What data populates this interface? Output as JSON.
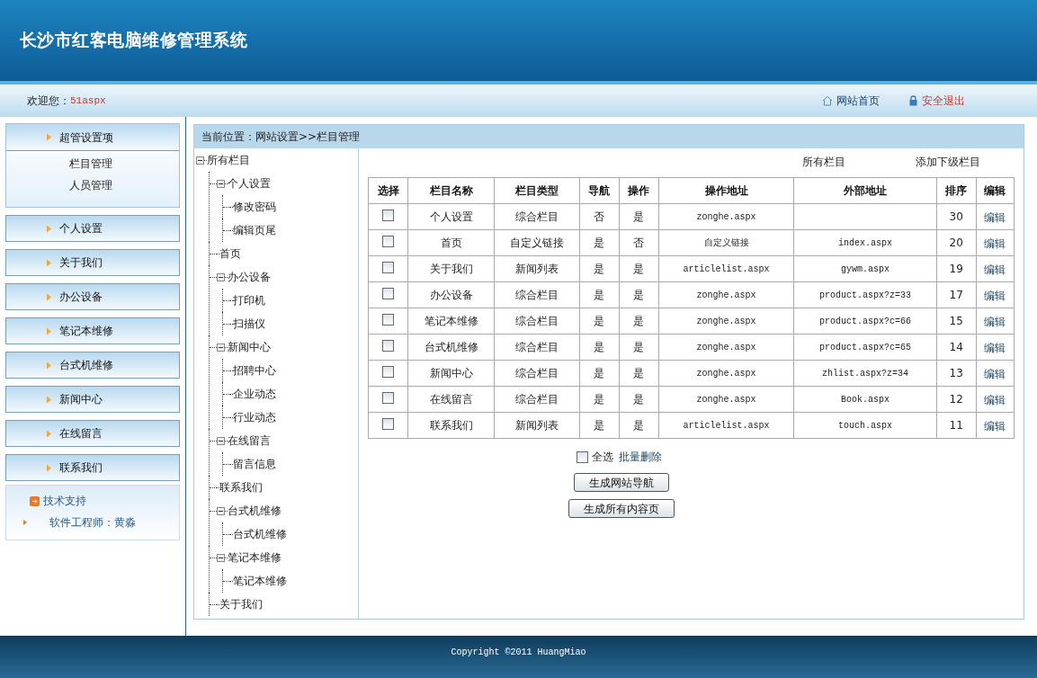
{
  "header": {
    "title": "长沙市红客电脑维修管理系统"
  },
  "topbar": {
    "welcome_label": "欢迎您：",
    "user": "51aspx",
    "links": [
      {
        "kind": "home",
        "label": "网站首页"
      },
      {
        "kind": "logout",
        "label": "安全退出"
      }
    ]
  },
  "sidebar": {
    "groups": [
      {
        "label": "超管设置项",
        "expanded": true,
        "items": [
          "栏目管理",
          "人员管理"
        ]
      },
      {
        "label": "个人设置",
        "expanded": false
      },
      {
        "label": "关于我们",
        "expanded": false
      },
      {
        "label": "办公设备",
        "expanded": false
      },
      {
        "label": "笔记本维修",
        "expanded": false
      },
      {
        "label": "台式机维修",
        "expanded": false
      },
      {
        "label": "新闻中心",
        "expanded": false
      },
      {
        "label": "在线留言",
        "expanded": false
      },
      {
        "label": "联系我们",
        "expanded": false
      }
    ],
    "support": {
      "title": "技术支持",
      "lines": [
        "软件工程师：黄淼"
      ]
    }
  },
  "breadcrumb": "当前位置：网站设置>>栏目管理",
  "tree": [
    {
      "label": "所有栏目",
      "children": [
        {
          "label": "个人设置",
          "children": [
            {
              "label": "修改密码"
            },
            {
              "label": "编辑页尾"
            }
          ]
        },
        {
          "label": "首页"
        },
        {
          "label": "办公设备",
          "children": [
            {
              "label": "打印机"
            },
            {
              "label": "扫描仪"
            }
          ]
        },
        {
          "label": "新闻中心",
          "children": [
            {
              "label": "招聘中心"
            },
            {
              "label": "企业动态"
            },
            {
              "label": "行业动态"
            }
          ]
        },
        {
          "label": "在线留言",
          "children": [
            {
              "label": "留言信息"
            }
          ]
        },
        {
          "label": "联系我们"
        },
        {
          "label": "台式机维修",
          "children": [
            {
              "label": "台式机维修"
            }
          ]
        },
        {
          "label": "笔记本维修",
          "children": [
            {
              "label": "笔记本维修"
            }
          ]
        },
        {
          "label": "关于我们"
        }
      ]
    }
  ],
  "actions": [
    "所有栏目",
    "添加下级栏目"
  ],
  "table": {
    "columns": [
      "选择",
      "栏目名称",
      "栏目类型",
      "导航",
      "操作",
      "操作地址",
      "外部地址",
      "排序",
      "编辑"
    ],
    "rows": [
      {
        "checked": false,
        "name": "个人设置",
        "type": "综合栏目",
        "nav": "否",
        "op": "是",
        "op_url": "zonghe.aspx",
        "order": "30",
        "edit": "编辑"
      },
      {
        "checked": false,
        "name": "首页",
        "type": "自定义链接",
        "nav": "是",
        "op": "否",
        "op_url": "自定义链接",
        "ext_url": "index.aspx",
        "order": "20",
        "edit": "编辑"
      },
      {
        "checked": false,
        "name": "关于我们",
        "type": "新闻列表",
        "nav": "是",
        "op": "是",
        "op_url": "articlelist.aspx",
        "ext_url": "gywm.aspx",
        "order": "19",
        "edit": "编辑"
      },
      {
        "checked": false,
        "name": "办公设备",
        "type": "综合栏目",
        "nav": "是",
        "op": "是",
        "op_url": "zonghe.aspx",
        "ext_url": "product.aspx?z=33",
        "order": "17",
        "edit": "编辑"
      },
      {
        "checked": false,
        "name": "笔记本维修",
        "type": "综合栏目",
        "nav": "是",
        "op": "是",
        "op_url": "zonghe.aspx",
        "ext_url": "product.aspx?c=66",
        "order": "15",
        "edit": "编辑"
      },
      {
        "checked": false,
        "name": "台式机维修",
        "type": "综合栏目",
        "nav": "是",
        "op": "是",
        "op_url": "zonghe.aspx",
        "ext_url": "product.aspx?c=65",
        "order": "14",
        "edit": "编辑"
      },
      {
        "checked": false,
        "name": "新闻中心",
        "type": "综合栏目",
        "nav": "是",
        "op": "是",
        "op_url": "zonghe.aspx",
        "ext_url": "zhlist.aspx?z=34",
        "order": "13",
        "edit": "编辑"
      },
      {
        "checked": false,
        "name": "在线留言",
        "type": "综合栏目",
        "nav": "是",
        "op": "是",
        "op_url": "zonghe.aspx",
        "ext_url": "Book.aspx",
        "order": "12",
        "edit": "编辑"
      },
      {
        "checked": false,
        "name": "联系我们",
        "type": "新闻列表",
        "nav": "是",
        "op": "是",
        "op_url": "articlelist.aspx",
        "ext_url": "touch.aspx",
        "order": "11",
        "edit": "编辑"
      }
    ]
  },
  "select_all": {
    "label": "全选",
    "checked": false
  },
  "batch_delete": "批量删除",
  "buttons": [
    "生成网站导航",
    "生成所有内容页"
  ],
  "footer": "Copyright ©2011 HuangMiao"
}
